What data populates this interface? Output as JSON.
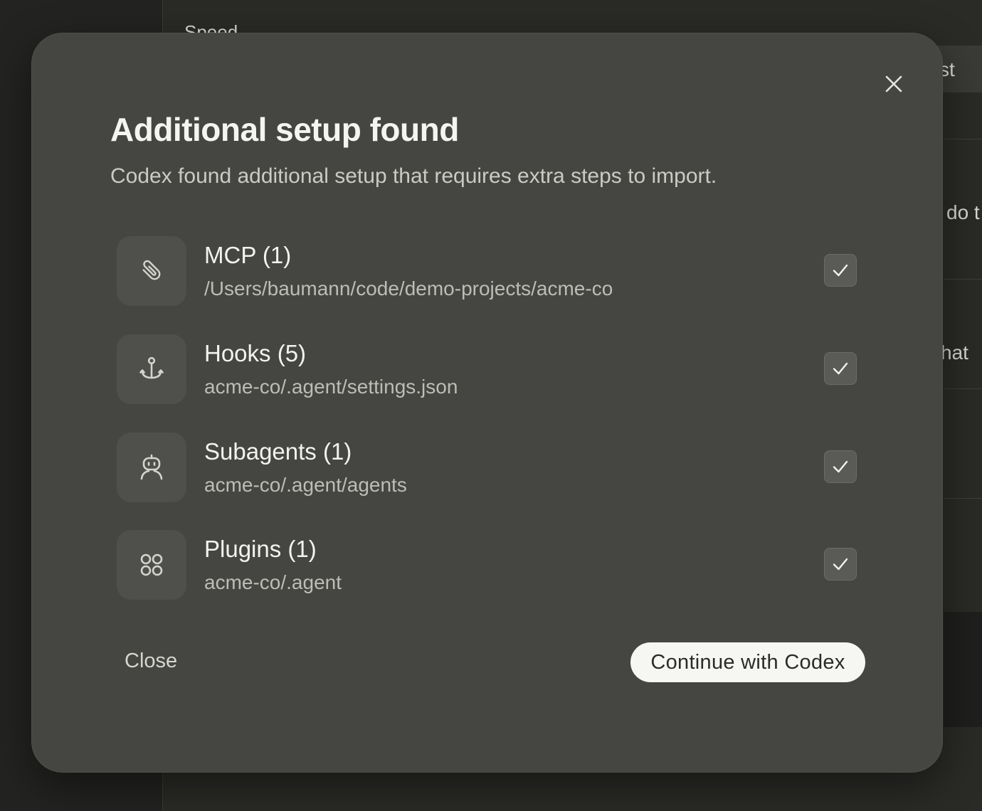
{
  "background": {
    "top_text": "Speed",
    "right_fragments": [
      "st",
      "do t",
      "hat"
    ]
  },
  "modal": {
    "title": "Additional setup found",
    "subtitle": "Codex found additional setup that requires extra steps to import.",
    "items": [
      {
        "icon": "paperclip-icon",
        "title": "MCP (1)",
        "path": "/Users/baumann/code/demo-projects/acme-co",
        "checked": true
      },
      {
        "icon": "anchor-icon",
        "title": "Hooks (5)",
        "path": "acme-co/.agent/settings.json",
        "checked": true
      },
      {
        "icon": "robot-icon",
        "title": "Subagents (1)",
        "path": "acme-co/.agent/agents",
        "checked": true
      },
      {
        "icon": "grid-dots-icon",
        "title": "Plugins (1)",
        "path": "acme-co/.agent",
        "checked": true
      }
    ],
    "close_label": "Close",
    "continue_label": "Continue with Codex"
  },
  "colors": {
    "modal_bg": "#454541",
    "icon_tile_bg": "#4f4f4b",
    "primary_button_bg": "#f6f6f2",
    "backdrop": "#232321"
  }
}
